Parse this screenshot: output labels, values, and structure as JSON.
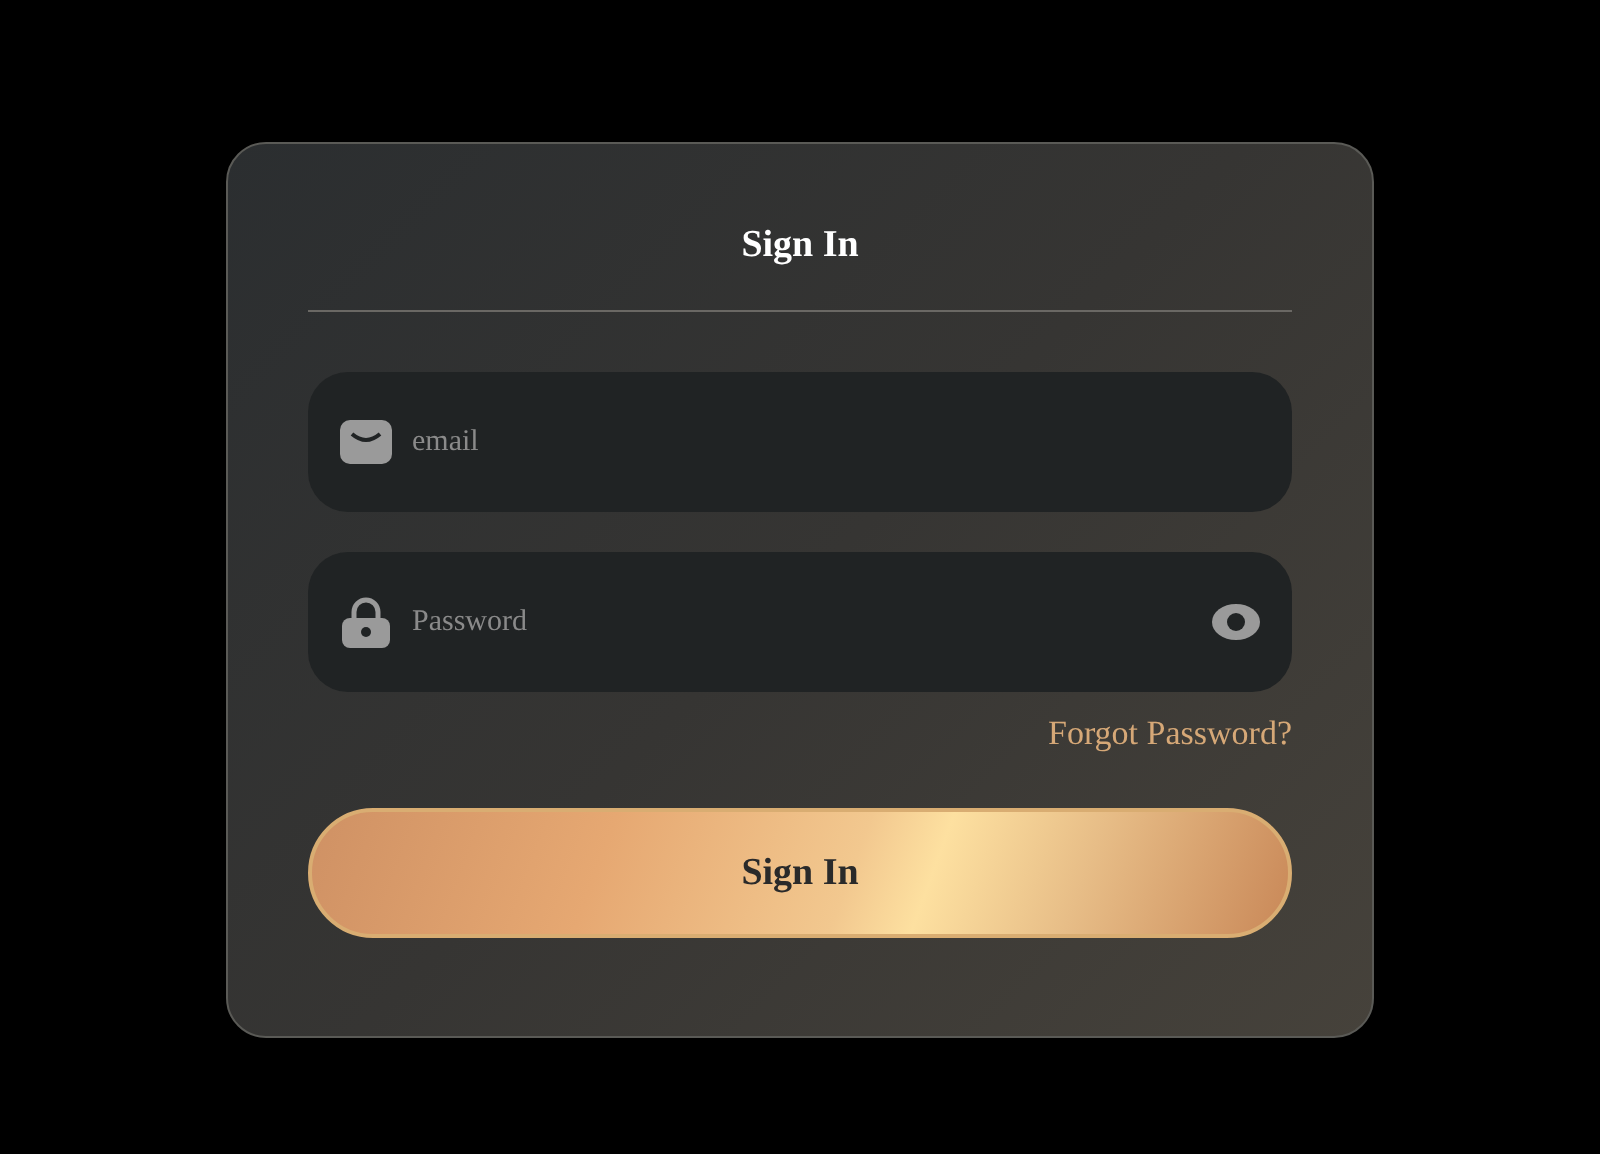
{
  "title": "Sign In",
  "fields": [
    {
      "kind": "email",
      "placeholder": "email"
    },
    {
      "kind": "password",
      "placeholder": "Password"
    }
  ],
  "forgot_link": "Forgot Password?",
  "submit_button": "Sign In"
}
